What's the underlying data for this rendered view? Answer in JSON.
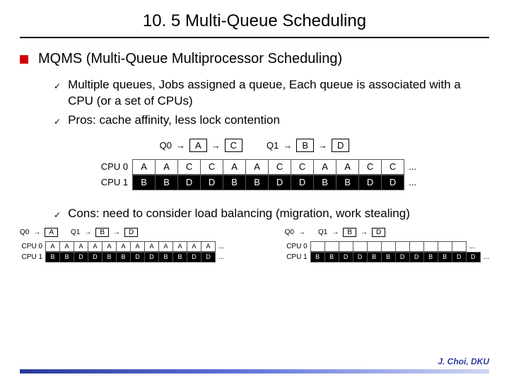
{
  "title": "10. 5 Multi-Queue Scheduling",
  "h1": "MQMS (Multi-Queue Multiprocessor Scheduling)",
  "bullets": {
    "b1": "Multiple queues, Jobs assigned a queue, Each queue is associated with a CPU (or a set of CPUs)",
    "b2": "Pros: cache affinity, less lock contention",
    "b3": "Cons: need to consider load balancing (migration, work stealing)"
  },
  "check": "✓",
  "arrow": "→",
  "dots": "...",
  "fig1": {
    "q0": {
      "label": "Q0",
      "items": [
        "A",
        "C"
      ]
    },
    "q1": {
      "label": "Q1",
      "items": [
        "B",
        "D"
      ]
    },
    "cpu0": {
      "label": "CPU 0",
      "slots": [
        "A",
        "A",
        "C",
        "C",
        "A",
        "A",
        "C",
        "C",
        "A",
        "A",
        "C",
        "C"
      ]
    },
    "cpu1": {
      "label": "CPU 1",
      "slots": [
        "B",
        "B",
        "D",
        "D",
        "B",
        "B",
        "D",
        "D",
        "B",
        "B",
        "D",
        "D"
      ]
    }
  },
  "fig2left": {
    "q0": {
      "label": "Q0",
      "items": [
        "A"
      ]
    },
    "q1": {
      "label": "Q1",
      "items": [
        "B",
        "D"
      ]
    },
    "cpu0": {
      "label": "CPU 0",
      "slots": [
        "A",
        "A",
        "A",
        "A",
        "A",
        "A",
        "A",
        "A",
        "A",
        "A",
        "A",
        "A"
      ]
    },
    "cpu1": {
      "label": "CPU 1",
      "slots": [
        "B",
        "B",
        "D",
        "D",
        "B",
        "B",
        "D",
        "D",
        "B",
        "B",
        "D",
        "D"
      ]
    }
  },
  "fig2right": {
    "q0": {
      "label": "Q0",
      "items": []
    },
    "q1": {
      "label": "Q1",
      "items": [
        "B",
        "D"
      ]
    },
    "cpu0": {
      "label": "CPU 0",
      "slots": [
        "",
        "",
        "",
        "",
        "",
        "",
        "",
        "",
        "",
        "",
        ""
      ]
    },
    "cpu1": {
      "label": "CPU 1",
      "slots": [
        "B",
        "B",
        "D",
        "D",
        "B",
        "B",
        "D",
        "D",
        "B",
        "B",
        "D",
        "D"
      ]
    }
  },
  "credit": "J. Choi, DKU"
}
